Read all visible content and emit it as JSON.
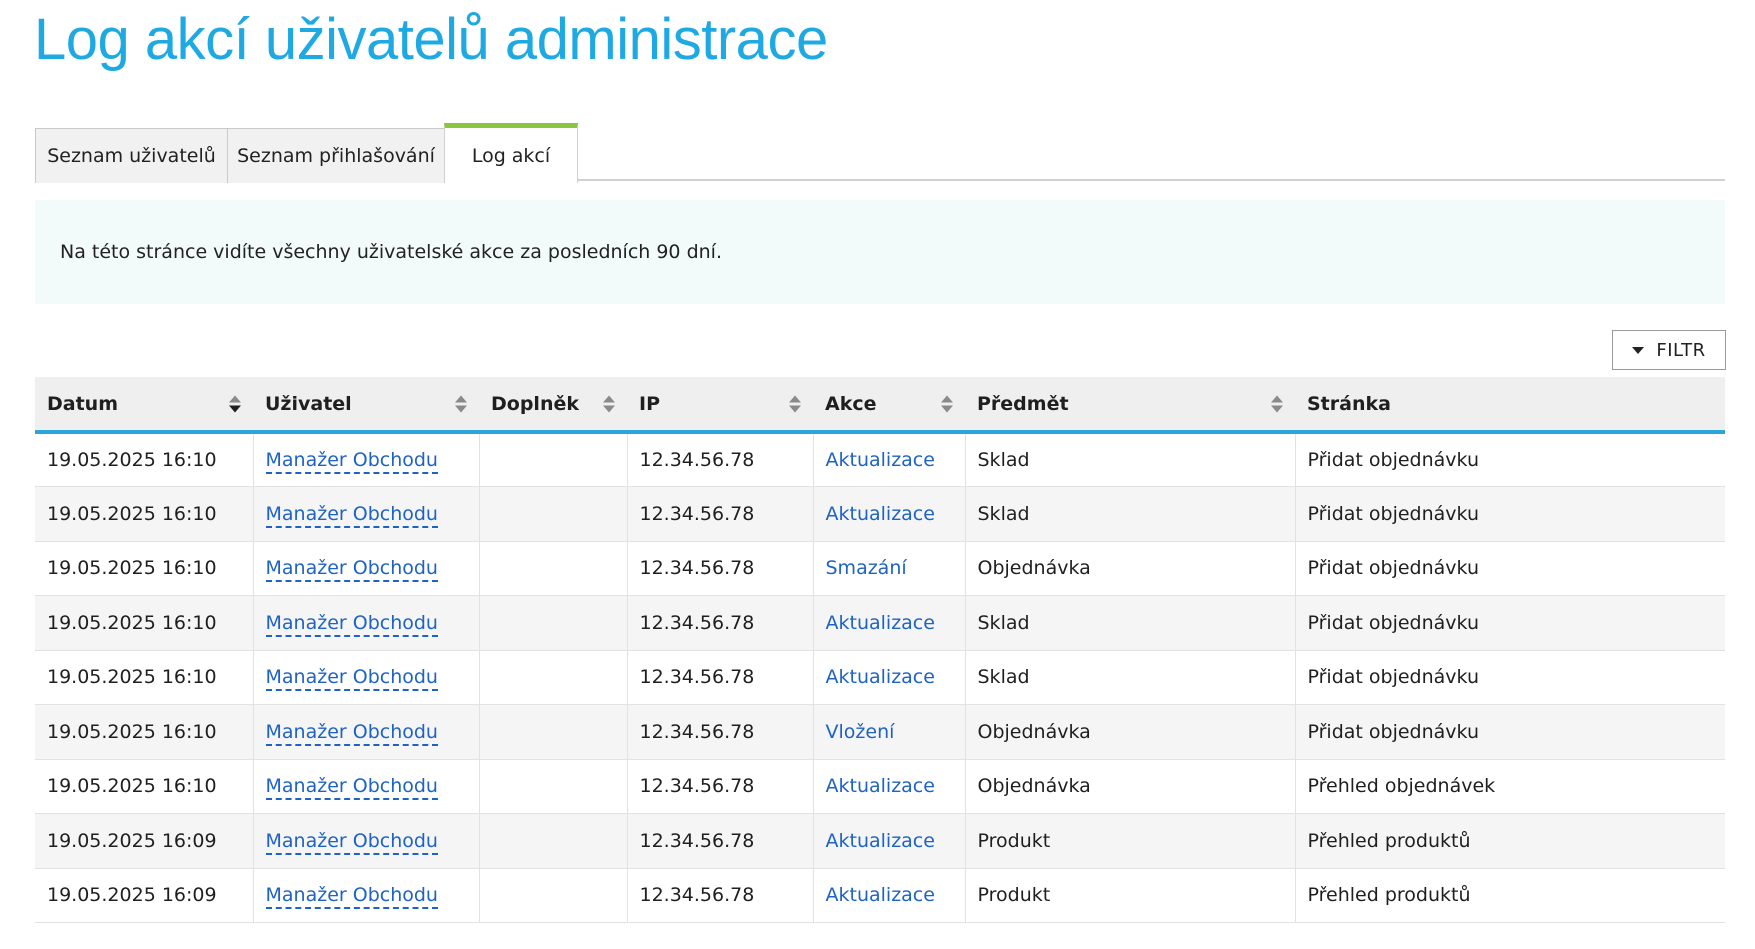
{
  "page": {
    "title": "Log akcí uživatelů administrace"
  },
  "tabs": [
    {
      "label": "Seznam uživatelů",
      "active": false
    },
    {
      "label": "Seznam přihlašování",
      "active": false
    },
    {
      "label": "Log akcí",
      "active": true
    }
  ],
  "info": {
    "text": "Na této stránce vidíte všechny uživatelské akce za posledních 90 dní."
  },
  "filter": {
    "label": "FILTR"
  },
  "table": {
    "columns": [
      "Datum",
      "Uživatel",
      "Doplněk",
      "IP",
      "Akce",
      "Předmět",
      "Stránka"
    ],
    "rows": [
      {
        "date": "19.05.2025 16:10",
        "user": "Manažer Obchodu",
        "addon": "",
        "ip": "12.34.56.78",
        "action": "Aktualizace",
        "subject": "Sklad",
        "page": "Přidat objednávku"
      },
      {
        "date": "19.05.2025 16:10",
        "user": "Manažer Obchodu",
        "addon": "",
        "ip": "12.34.56.78",
        "action": "Aktualizace",
        "subject": "Sklad",
        "page": "Přidat objednávku"
      },
      {
        "date": "19.05.2025 16:10",
        "user": "Manažer Obchodu",
        "addon": "",
        "ip": "12.34.56.78",
        "action": "Smazání",
        "subject": "Objednávka",
        "page": "Přidat objednávku"
      },
      {
        "date": "19.05.2025 16:10",
        "user": "Manažer Obchodu",
        "addon": "",
        "ip": "12.34.56.78",
        "action": "Aktualizace",
        "subject": "Sklad",
        "page": "Přidat objednávku"
      },
      {
        "date": "19.05.2025 16:10",
        "user": "Manažer Obchodu",
        "addon": "",
        "ip": "12.34.56.78",
        "action": "Aktualizace",
        "subject": "Sklad",
        "page": "Přidat objednávku"
      },
      {
        "date": "19.05.2025 16:10",
        "user": "Manažer Obchodu",
        "addon": "",
        "ip": "12.34.56.78",
        "action": "Vložení",
        "subject": "Objednávka",
        "page": "Přidat objednávku"
      },
      {
        "date": "19.05.2025 16:10",
        "user": "Manažer Obchodu",
        "addon": "",
        "ip": "12.34.56.78",
        "action": "Aktualizace",
        "subject": "Objednávka",
        "page": "Přehled objednávek"
      },
      {
        "date": "19.05.2025 16:09",
        "user": "Manažer Obchodu",
        "addon": "",
        "ip": "12.34.56.78",
        "action": "Aktualizace",
        "subject": "Produkt",
        "page": "Přehled produktů"
      },
      {
        "date": "19.05.2025 16:09",
        "user": "Manažer Obchodu",
        "addon": "",
        "ip": "12.34.56.78",
        "action": "Aktualizace",
        "subject": "Produkt",
        "page": "Přehled produktů"
      }
    ]
  },
  "colors": {
    "title": "#1fa9e3",
    "link": "#1e63c4",
    "active_tab": "#8cc63f",
    "header_rule": "#2aa6dc",
    "info_bg": "#f2fafa"
  }
}
